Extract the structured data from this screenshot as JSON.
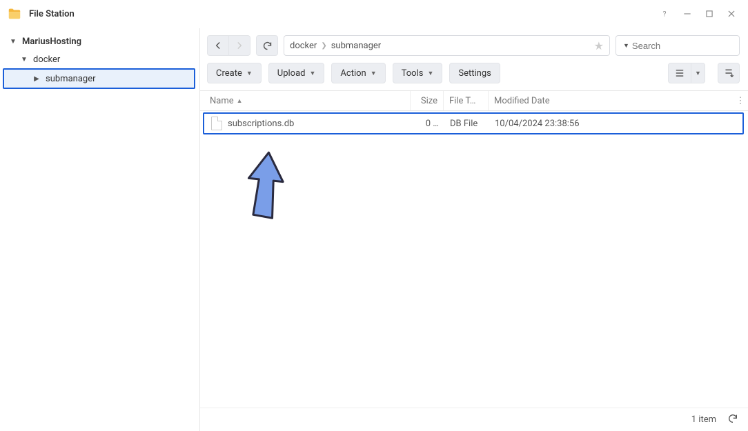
{
  "window": {
    "title": "File Station"
  },
  "sidebar": {
    "root": "MariusHosting",
    "level1": "docker",
    "level2": "submanager"
  },
  "breadcrumb": {
    "c0": "docker",
    "c1": "submanager"
  },
  "search": {
    "placeholder": "Search"
  },
  "actions": {
    "create": "Create",
    "upload": "Upload",
    "action": "Action",
    "tools": "Tools",
    "settings": "Settings"
  },
  "columns": {
    "name": "Name",
    "size": "Size",
    "type": "File T…",
    "date": "Modified Date"
  },
  "files": [
    {
      "name": "subscriptions.db",
      "size": "0 …",
      "type": "DB File",
      "modified": "10/04/2024 23:38:56"
    }
  ],
  "status": {
    "count": "1 item"
  }
}
